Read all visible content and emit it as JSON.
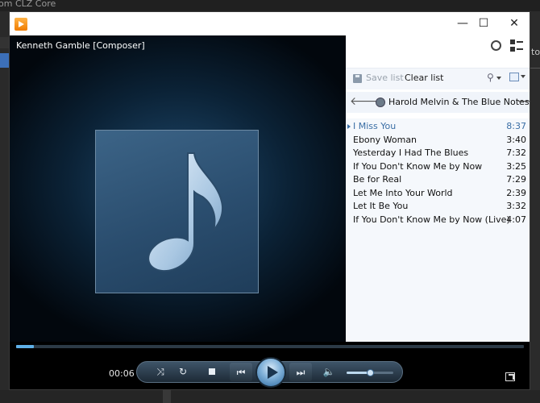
{
  "background_app": {
    "title": "om CLZ Core",
    "right_edge_text": "to"
  },
  "window": {
    "icon": "media-player-icon",
    "minimize": "—",
    "maximize": "☐",
    "close": "✕"
  },
  "video": {
    "now_playing": "Kenneth Gamble [Composer]",
    "album_art_icon": "music-note-icon"
  },
  "playlist": {
    "save_list": "Save list",
    "clear_list": "Clear list",
    "artist": "Harold Melvin & The Blue Notes",
    "tracks": [
      {
        "name": "I Miss You",
        "duration": "8:37",
        "current": true
      },
      {
        "name": "Ebony Woman",
        "duration": "3:40",
        "current": false
      },
      {
        "name": "Yesterday I Had The Blues",
        "duration": "7:32",
        "current": false
      },
      {
        "name": "If You Don't Know Me by Now",
        "duration": "3:25",
        "current": false
      },
      {
        "name": "Be for Real",
        "duration": "7:29",
        "current": false
      },
      {
        "name": "Let Me Into Your World",
        "duration": "2:39",
        "current": false
      },
      {
        "name": "Let It Be You",
        "duration": "3:32",
        "current": false
      },
      {
        "name": "If You Don't Know Me by Now (Live)",
        "duration": "4:07",
        "current": false
      }
    ]
  },
  "controls": {
    "elapsed": "00:06",
    "seek_progress": 0.035,
    "volume_level": 0.5,
    "accent_color": "#3a6ea5"
  }
}
